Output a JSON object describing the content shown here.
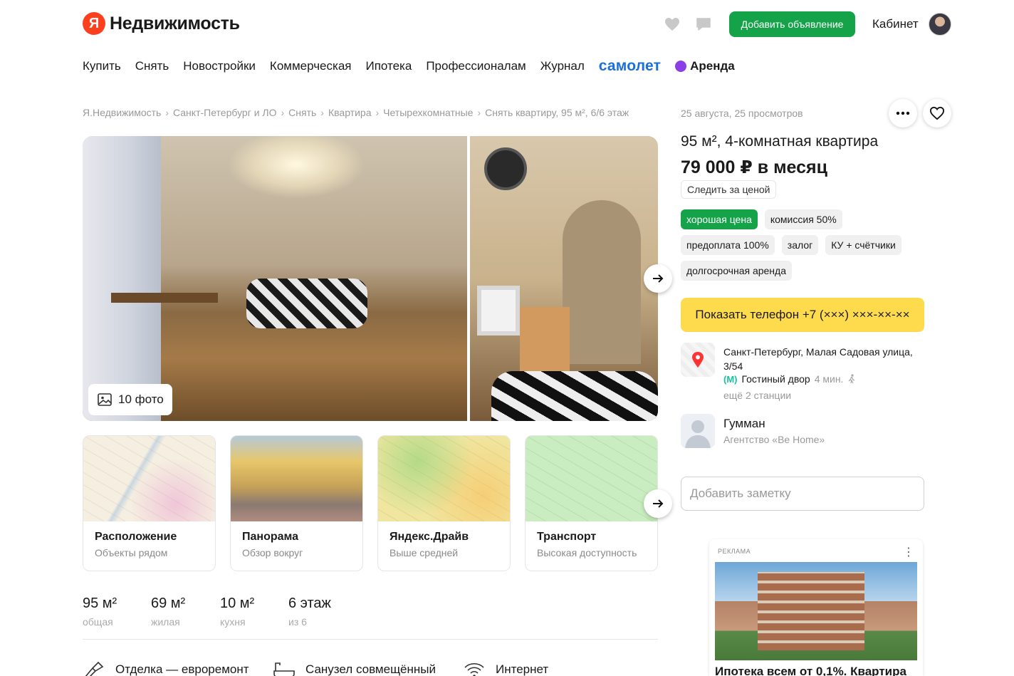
{
  "header": {
    "logo_letter": "Я",
    "logo_text": "Недвижимость",
    "add_button": "Добавить объявление",
    "cabinet": "Кабинет",
    "accent": "#15a34a"
  },
  "nav": {
    "items": [
      "Купить",
      "Снять",
      "Новостройки",
      "Коммерческая",
      "Ипотека",
      "Профессионалам",
      "Журнал"
    ],
    "samolet": "самолет",
    "arenda": "Аренда"
  },
  "breadcrumb": [
    "Я.Недвижимость",
    "Санкт-Петербург и ЛО",
    "Снять",
    "Квартира",
    "Четырехкомнатные",
    "Снять квартиру, 95 м², 6/6 этаж"
  ],
  "gallery": {
    "photo_count": "10 фото"
  },
  "cards": [
    {
      "title": "Расположение",
      "subtitle": "Объекты рядом"
    },
    {
      "title": "Панорама",
      "subtitle": "Обзор вокруг"
    },
    {
      "title": "Яндекс.Драйв",
      "subtitle": "Выше средней"
    },
    {
      "title": "Транспорт",
      "subtitle": "Высокая доступность"
    }
  ],
  "specs": [
    {
      "value": "95 м²",
      "label": "общая"
    },
    {
      "value": "69 м²",
      "label": "жилая"
    },
    {
      "value": "10 м²",
      "label": "кухня"
    },
    {
      "value": "6 этаж",
      "label": "из 6"
    }
  ],
  "features": [
    "Отделка — евроремонт",
    "Санузел совмещённый",
    "Интернет"
  ],
  "listing": {
    "meta": "25 августа, 25 просмотров",
    "title": "95 м², 4-комнатная квартира",
    "price": "79 000 ₽ в месяц",
    "follow_price": "Следить за ценой",
    "tags": [
      {
        "text": "хорошая цена",
        "highlight": true
      },
      {
        "text": "комиссия 50%",
        "highlight": false
      },
      {
        "text": "предоплата 100%",
        "highlight": false
      },
      {
        "text": "залог",
        "highlight": false
      },
      {
        "text": "КУ + счётчики",
        "highlight": false
      },
      {
        "text": "долгосрочная аренда",
        "highlight": false
      }
    ],
    "phone_button": "Показать телефон +7 (×××) ×××-××-××",
    "phone_button_color": "#fedb4d",
    "address": "Санкт-Петербург, Малая Садовая улица, 3/54",
    "metro_station": "Гостиный двор",
    "metro_time": "4 мин.",
    "more_stations": "ещё 2 станции",
    "agent_name": "Гумман",
    "agent_org": "Агентство «Be Home»",
    "note_placeholder": "Добавить заметку"
  },
  "ad": {
    "label": "РЕКЛАМА",
    "title": "Ипотека всем от 0,1%. Квартира"
  }
}
